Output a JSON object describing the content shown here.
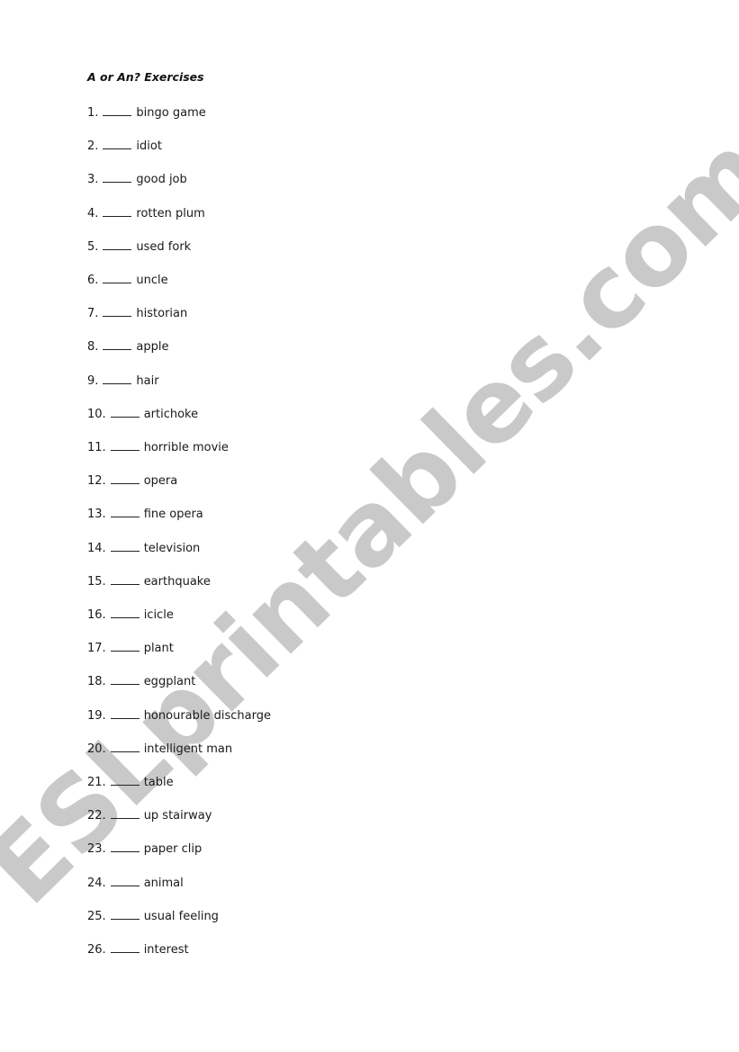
{
  "document": {
    "title": "A or An? Exercises",
    "blank": "____",
    "items": [
      {
        "number": "1.",
        "phrase": "bingo game"
      },
      {
        "number": "2.",
        "phrase": "idiot"
      },
      {
        "number": "3.",
        "phrase": "good job"
      },
      {
        "number": "4.",
        "phrase": "rotten plum"
      },
      {
        "number": "5.",
        "phrase": "used fork"
      },
      {
        "number": "6.",
        "phrase": "uncle"
      },
      {
        "number": "7.",
        "phrase": "historian"
      },
      {
        "number": "8.",
        "phrase": "apple"
      },
      {
        "number": "9.",
        "phrase": "hair"
      },
      {
        "number": "10.",
        "phrase": "artichoke"
      },
      {
        "number": "11.",
        "phrase": "horrible movie"
      },
      {
        "number": "12.",
        "phrase": "opera"
      },
      {
        "number": "13.",
        "phrase": "fine opera"
      },
      {
        "number": "14.",
        "phrase": "television"
      },
      {
        "number": "15.",
        "phrase": "earthquake"
      },
      {
        "number": "16.",
        "phrase": "icicle"
      },
      {
        "number": "17.",
        "phrase": "plant"
      },
      {
        "number": "18.",
        "phrase": "eggplant"
      },
      {
        "number": "19.",
        "phrase": "honourable discharge"
      },
      {
        "number": "20.",
        "phrase": "intelligent man"
      },
      {
        "number": "21.",
        "phrase": "table"
      },
      {
        "number": "22.",
        "phrase": "up stairway"
      },
      {
        "number": "23.",
        "phrase": "paper clip"
      },
      {
        "number": "24.",
        "phrase": "animal"
      },
      {
        "number": "25.",
        "phrase": "usual feeling"
      },
      {
        "number": "26.",
        "phrase": "interest"
      }
    ]
  },
  "watermark": {
    "text": "ESLprintables.com",
    "color": "#c9c9c9"
  }
}
